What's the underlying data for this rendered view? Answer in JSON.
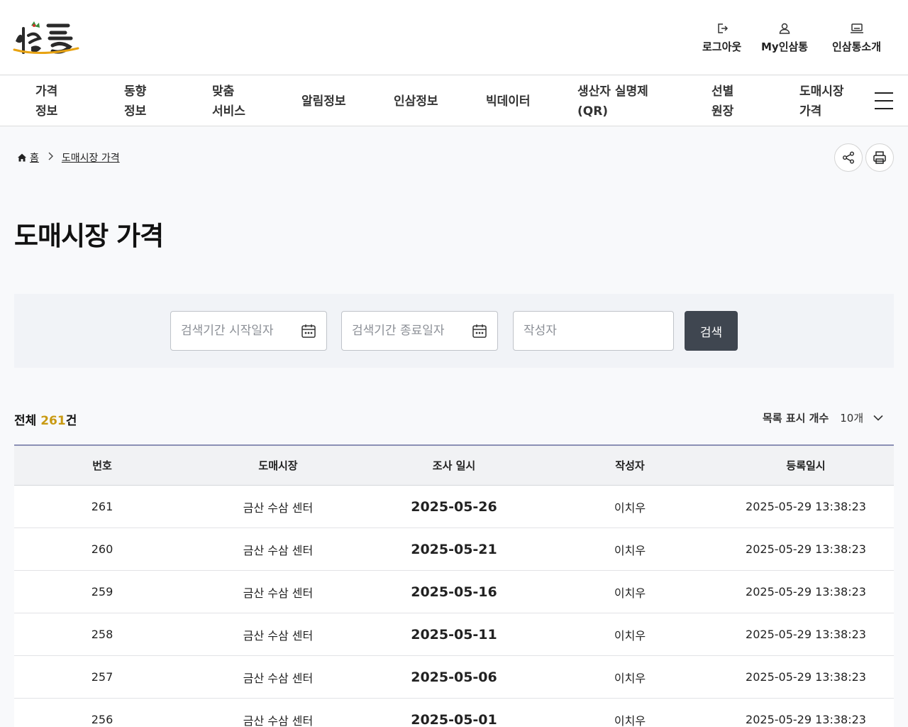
{
  "brand": {
    "logo_alt": "인삼통"
  },
  "header": {
    "util": [
      {
        "label": "로그아웃",
        "icon": "logout-icon"
      },
      {
        "label": "My인삼통",
        "icon": "user-icon"
      },
      {
        "label": "인삼통소개",
        "icon": "laptop-icon"
      }
    ]
  },
  "gnb": {
    "items": [
      "가격\n정보",
      "동향\n정보",
      "맞춤\n서비스",
      "알림정보",
      "인삼정보",
      "빅데이터",
      "생산자 실명제\n(QR)",
      "선별\n원장",
      "도매시장\n가격"
    ]
  },
  "breadcrumb": {
    "home": "홈",
    "current": "도매시장 가격"
  },
  "page": {
    "title": "도매시장 가격"
  },
  "search": {
    "start_placeholder": "검색기간 시작일자",
    "end_placeholder": "검색기간 종료일자",
    "writer_placeholder": "작성자",
    "button": "검색"
  },
  "summary": {
    "total_prefix": "전체 ",
    "total_count": "261",
    "total_suffix": "건",
    "per_page_label": "목록 표시 개수",
    "per_page_value": "10개"
  },
  "table": {
    "columns": [
      "번호",
      "도매시장",
      "조사 일시",
      "작성자",
      "등록일시"
    ],
    "rows": [
      {
        "no": "261",
        "market": "금산 수삼 센터",
        "date": "2025-05-26",
        "writer": "이치우",
        "registered": "2025-05-29 13:38:23"
      },
      {
        "no": "260",
        "market": "금산 수삼 센터",
        "date": "2025-05-21",
        "writer": "이치우",
        "registered": "2025-05-29 13:38:23"
      },
      {
        "no": "259",
        "market": "금산 수삼 센터",
        "date": "2025-05-16",
        "writer": "이치우",
        "registered": "2025-05-29 13:38:23"
      },
      {
        "no": "258",
        "market": "금산 수삼 센터",
        "date": "2025-05-11",
        "writer": "이치우",
        "registered": "2025-05-29 13:38:23"
      },
      {
        "no": "257",
        "market": "금산 수삼 센터",
        "date": "2025-05-06",
        "writer": "이치우",
        "registered": "2025-05-29 13:38:23"
      },
      {
        "no": "256",
        "market": "금산 수삼 센터",
        "date": "2025-05-01",
        "writer": "이치우",
        "registered": "2025-05-29 13:38:23"
      }
    ]
  },
  "colors": {
    "accent_gold": "#c99a13",
    "search_button": "#3f4650",
    "table_top_border": "#8c90b5"
  }
}
